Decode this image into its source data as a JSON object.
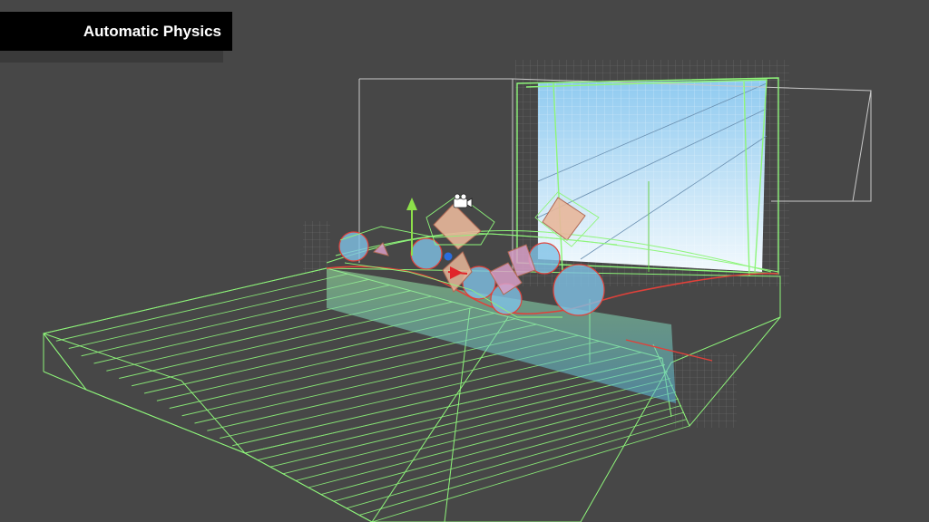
{
  "overlay": {
    "title": "Automatic Physics"
  },
  "colors": {
    "background": "#474747",
    "wireframe": "#8ef57a",
    "collider_edge": "#e0413a",
    "sky_top": "#9dd2f0",
    "sky_bottom": "#e9f5fc",
    "sphere_fill": "#7fc2e6",
    "box_fill": "#e8b79a",
    "gizmo_y": "#8de04a",
    "gizmo_x": "#e0262a",
    "gizmo_z": "#2a6de0"
  },
  "icons": {
    "camera": "camera-icon",
    "move_gizmo": "move-gizmo-icon"
  }
}
